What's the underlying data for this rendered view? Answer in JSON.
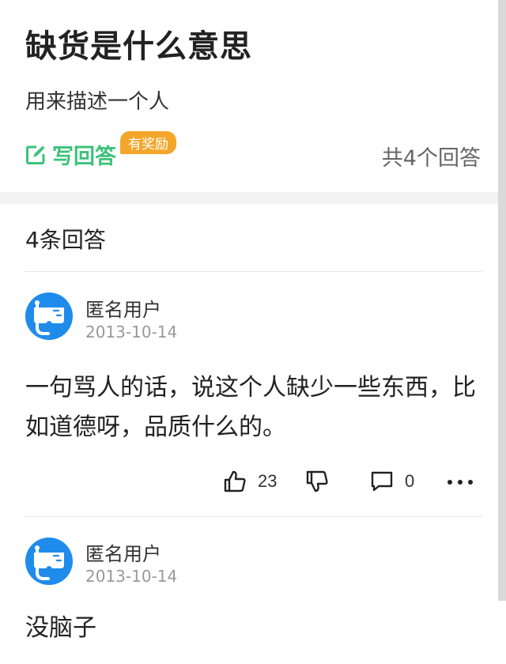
{
  "question": {
    "title": "缺货是什么意思",
    "description": "用来描述一个人",
    "write_answer_label": "写回答",
    "reward_badge": "有奖励",
    "answer_total": "共4个回答"
  },
  "answers_section": {
    "title": "4条回答"
  },
  "answers": [
    {
      "username": "匿名用户",
      "date": "2013-10-14",
      "content": "一句骂人的话，说这个人缺少一些东西，比如道德呀，品质什么的。",
      "likes": "23",
      "comments": "0"
    },
    {
      "username": "匿名用户",
      "date": "2013-10-14",
      "content": "没脑子"
    }
  ],
  "colors": {
    "accent_green": "#3cc27a",
    "reward_orange": "#f4a62a",
    "avatar_blue": "#1f8ceb"
  },
  "icons": {
    "write": "edit-icon",
    "like": "thumbs-up-icon",
    "dislike": "thumbs-down-icon",
    "comment": "comment-icon",
    "more": "more-icon",
    "avatar": "snorkel-avatar"
  }
}
